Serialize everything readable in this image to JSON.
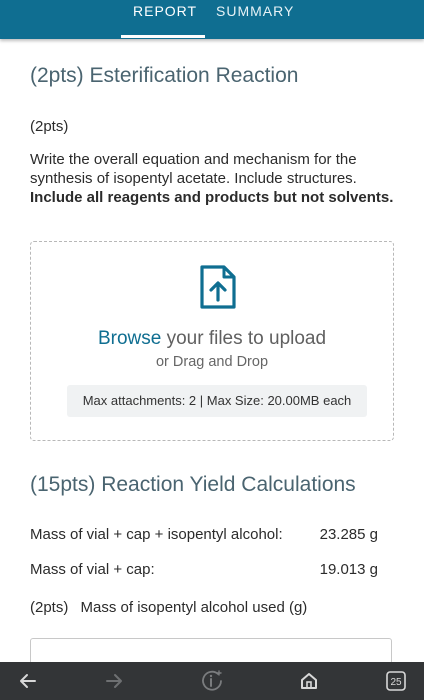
{
  "tabs": {
    "report": "REPORT",
    "summary": "SUMMARY"
  },
  "section1": {
    "title": "(2pts) Esterification Reaction",
    "points": "(2pts)",
    "prompt_normal": "Write the overall equation and mechanism for the synthesis of isopentyl acetate. Include structures. ",
    "prompt_bold": "Include all reagents and products but not solvents."
  },
  "upload": {
    "browse": "Browse",
    "rest": " your files to upload",
    "drag": "or Drag and Drop",
    "limits": "Max attachments: 2 | Max Size: 20.00MB each"
  },
  "section2": {
    "title": "(15pts) Reaction Yield Calculations",
    "rows": [
      {
        "label": "Mass of vial + cap + isopentyl alcohol:",
        "value": "23.285 g"
      },
      {
        "label": "Mass of vial + cap:",
        "value": "19.013 g"
      }
    ],
    "question_points": "(2pts)",
    "question_label": "Mass of isopentyl alcohol used (g)"
  },
  "bottom_nav": {
    "tab_count": "25"
  }
}
